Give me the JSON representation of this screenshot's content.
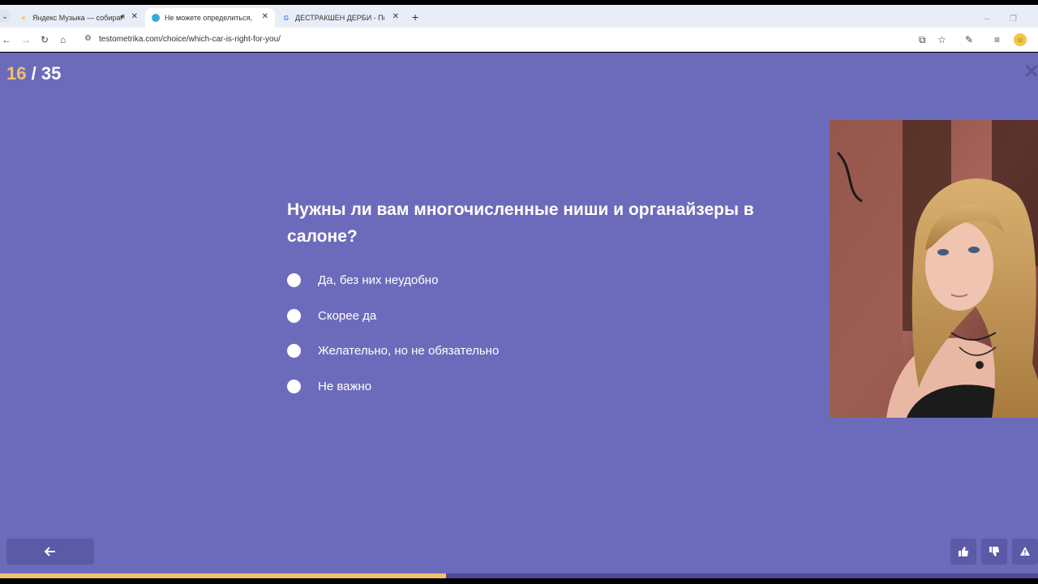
{
  "browser": {
    "tabs": [
      {
        "title": "Яндекс Музыка — собирае",
        "active": false,
        "has_sound": true
      },
      {
        "title": "Не можете определиться, как",
        "active": true,
        "has_sound": false
      },
      {
        "title": "ДЕСТРАКШЕН ДЕРБИ - Поиск",
        "active": false,
        "has_sound": false
      }
    ],
    "url": "testometrika.com/choice/which-car-is-right-for-you/"
  },
  "quiz": {
    "current": "16",
    "separator": " / ",
    "total": "35",
    "question": "Нужны ли вам многочисленные ниши и органайзеры в салоне?",
    "options": [
      "Да, без них неудобно",
      "Скорее да",
      "Желательно, но не обязательно",
      "Не важно"
    ],
    "progress_percent": 43
  },
  "colors": {
    "background": "#6c6bbb",
    "accent": "#f0c36a",
    "button": "#5b5aa6"
  },
  "icons": {
    "back": "arrow-left-icon",
    "like": "thumbs-up-icon",
    "dislike": "thumbs-down-icon",
    "report": "warning-icon",
    "close": "close-icon"
  }
}
